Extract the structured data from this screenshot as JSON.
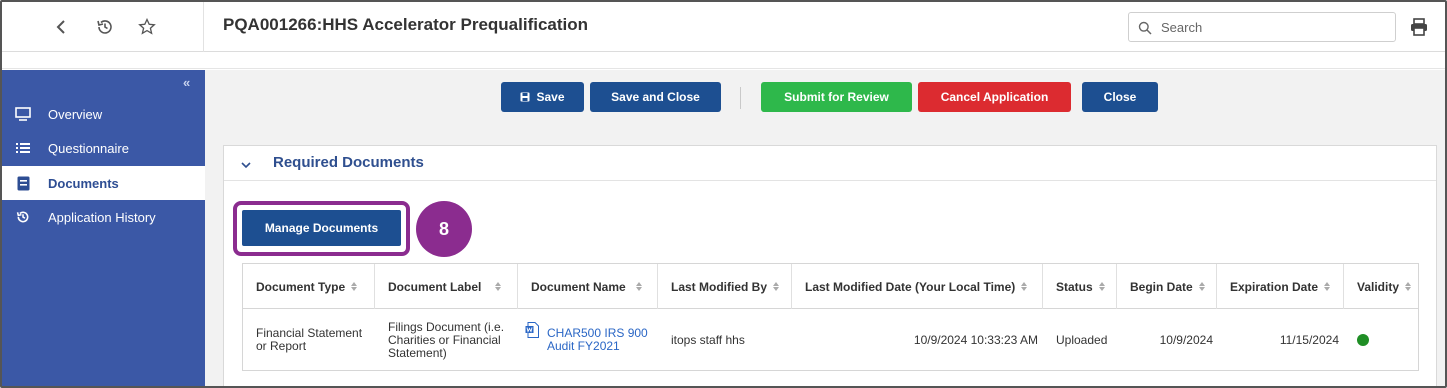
{
  "header": {
    "title": "PQA001266:HHS Accelerator Prequalification",
    "search_placeholder": "Search"
  },
  "sidebar": {
    "items": [
      {
        "label": "Overview",
        "icon": "monitor-icon"
      },
      {
        "label": "Questionnaire",
        "icon": "list-icon"
      },
      {
        "label": "Documents",
        "icon": "document-icon",
        "active": true
      },
      {
        "label": "Application History",
        "icon": "history-icon"
      }
    ]
  },
  "toolbar": {
    "save_label": "Save",
    "save_close_label": "Save and Close",
    "submit_label": "Submit for Review",
    "cancel_label": "Cancel Application",
    "close_label": "Close"
  },
  "section": {
    "title": "Required Documents",
    "manage_label": "Manage Documents",
    "step_badge": "8"
  },
  "table": {
    "columns": [
      "Document Type",
      "Document Label",
      "Document Name",
      "Last Modified By",
      "Last Modified Date (Your Local Time)",
      "Status",
      "Begin Date",
      "Expiration Date",
      "Validity"
    ],
    "rows": [
      {
        "document_type": "Financial Statement or Report",
        "document_label": "Filings Document (i.e. Charities or Financial Statement)",
        "document_name": "CHAR500 IRS 900 Audit FY2021",
        "last_modified_by": "itops staff hhs",
        "last_modified_date": "10/9/2024 10:33:23 AM",
        "status": "Uploaded",
        "begin_date": "10/9/2024",
        "expiration_date": "11/15/2024",
        "validity_color": "#1f8e25"
      }
    ]
  },
  "colors": {
    "sidebar": "#3b58a6",
    "primary_button": "#1d4f91",
    "submit_button": "#2eb84b",
    "cancel_button": "#dc2b30",
    "highlight": "#8b2c8f"
  }
}
